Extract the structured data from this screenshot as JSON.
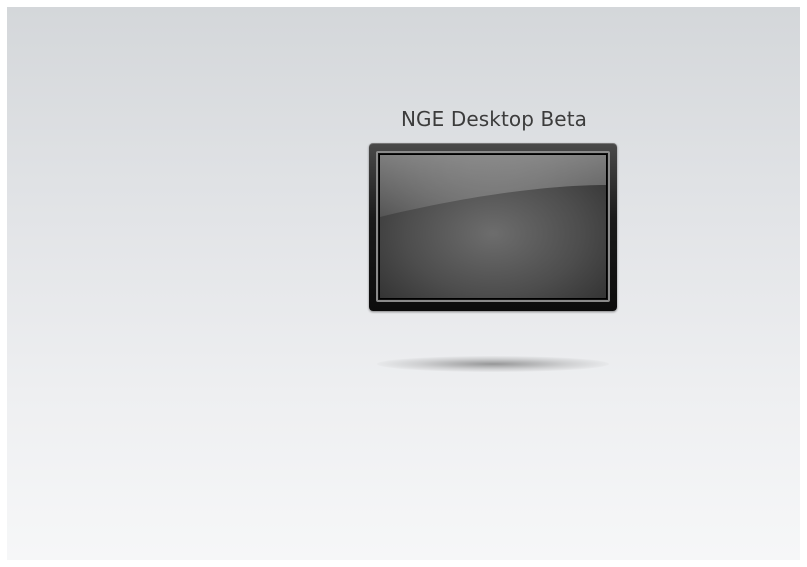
{
  "desktop": {
    "device_label": "NGE Desktop Beta",
    "device_icon": "monitor-icon"
  }
}
